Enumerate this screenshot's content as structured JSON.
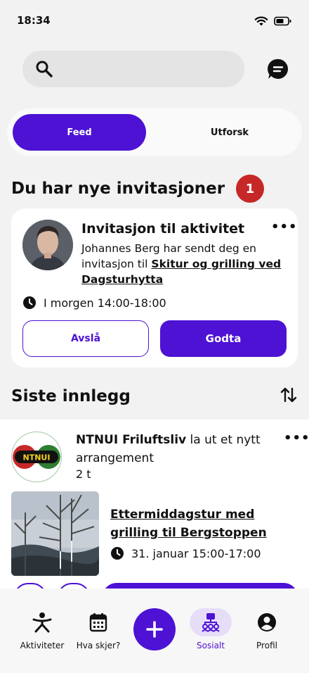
{
  "status_bar": {
    "time": "18:34"
  },
  "search": {
    "placeholder": ""
  },
  "segments": {
    "feed": "Feed",
    "explore": "Utforsk"
  },
  "invitations": {
    "title": "Du har nye invitasjoner",
    "count": "1",
    "card": {
      "title": "Invitasjon til aktivitet",
      "text_prefix": "Johannes Berg har sendt deg en invitasjon til ",
      "activity_link": "Skitur og grilling ved Dagsturhytta",
      "time": "I morgen 14:00-18:00",
      "decline_label": "Avslå",
      "accept_label": "Godta",
      "more": "•••"
    }
  },
  "posts": {
    "title": "Siste innlegg",
    "items": [
      {
        "org": "NTNUI Friluftsliv",
        "action": " la ut et nytt arrangement",
        "ago": "2 t",
        "logo_text": "NTNUI",
        "event_title": "Ettermiddagstur med grilling til Bergstoppen",
        "event_time": "31. januar 15:00-17:00",
        "more": "•••"
      }
    ]
  },
  "nav": {
    "items": [
      {
        "label": "Aktiviteter",
        "icon": "person-activity-icon"
      },
      {
        "label": "Hva skjer?",
        "icon": "calendar-icon"
      },
      {
        "label": "Sosialt",
        "icon": "social-group-icon",
        "active": true
      },
      {
        "label": "Profil",
        "icon": "profile-icon"
      }
    ]
  },
  "colors": {
    "accent": "#4d12d4",
    "badge": "#c62828",
    "active_pill": "#e6def9"
  }
}
